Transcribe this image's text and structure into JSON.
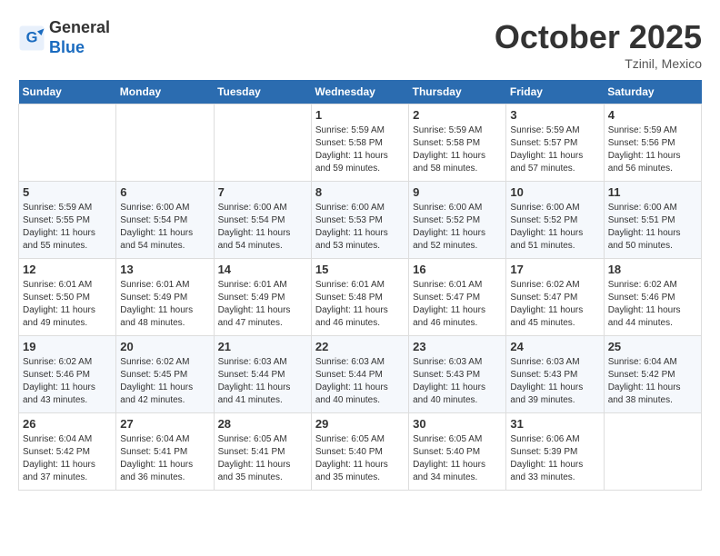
{
  "header": {
    "logo_line1": "General",
    "logo_line2": "Blue",
    "month": "October 2025",
    "location": "Tzinil, Mexico"
  },
  "weekdays": [
    "Sunday",
    "Monday",
    "Tuesday",
    "Wednesday",
    "Thursday",
    "Friday",
    "Saturday"
  ],
  "weeks": [
    [
      {
        "day": "",
        "info": ""
      },
      {
        "day": "",
        "info": ""
      },
      {
        "day": "",
        "info": ""
      },
      {
        "day": "1",
        "info": "Sunrise: 5:59 AM\nSunset: 5:58 PM\nDaylight: 11 hours\nand 59 minutes."
      },
      {
        "day": "2",
        "info": "Sunrise: 5:59 AM\nSunset: 5:58 PM\nDaylight: 11 hours\nand 58 minutes."
      },
      {
        "day": "3",
        "info": "Sunrise: 5:59 AM\nSunset: 5:57 PM\nDaylight: 11 hours\nand 57 minutes."
      },
      {
        "day": "4",
        "info": "Sunrise: 5:59 AM\nSunset: 5:56 PM\nDaylight: 11 hours\nand 56 minutes."
      }
    ],
    [
      {
        "day": "5",
        "info": "Sunrise: 5:59 AM\nSunset: 5:55 PM\nDaylight: 11 hours\nand 55 minutes."
      },
      {
        "day": "6",
        "info": "Sunrise: 6:00 AM\nSunset: 5:54 PM\nDaylight: 11 hours\nand 54 minutes."
      },
      {
        "day": "7",
        "info": "Sunrise: 6:00 AM\nSunset: 5:54 PM\nDaylight: 11 hours\nand 54 minutes."
      },
      {
        "day": "8",
        "info": "Sunrise: 6:00 AM\nSunset: 5:53 PM\nDaylight: 11 hours\nand 53 minutes."
      },
      {
        "day": "9",
        "info": "Sunrise: 6:00 AM\nSunset: 5:52 PM\nDaylight: 11 hours\nand 52 minutes."
      },
      {
        "day": "10",
        "info": "Sunrise: 6:00 AM\nSunset: 5:52 PM\nDaylight: 11 hours\nand 51 minutes."
      },
      {
        "day": "11",
        "info": "Sunrise: 6:00 AM\nSunset: 5:51 PM\nDaylight: 11 hours\nand 50 minutes."
      }
    ],
    [
      {
        "day": "12",
        "info": "Sunrise: 6:01 AM\nSunset: 5:50 PM\nDaylight: 11 hours\nand 49 minutes."
      },
      {
        "day": "13",
        "info": "Sunrise: 6:01 AM\nSunset: 5:49 PM\nDaylight: 11 hours\nand 48 minutes."
      },
      {
        "day": "14",
        "info": "Sunrise: 6:01 AM\nSunset: 5:49 PM\nDaylight: 11 hours\nand 47 minutes."
      },
      {
        "day": "15",
        "info": "Sunrise: 6:01 AM\nSunset: 5:48 PM\nDaylight: 11 hours\nand 46 minutes."
      },
      {
        "day": "16",
        "info": "Sunrise: 6:01 AM\nSunset: 5:47 PM\nDaylight: 11 hours\nand 46 minutes."
      },
      {
        "day": "17",
        "info": "Sunrise: 6:02 AM\nSunset: 5:47 PM\nDaylight: 11 hours\nand 45 minutes."
      },
      {
        "day": "18",
        "info": "Sunrise: 6:02 AM\nSunset: 5:46 PM\nDaylight: 11 hours\nand 44 minutes."
      }
    ],
    [
      {
        "day": "19",
        "info": "Sunrise: 6:02 AM\nSunset: 5:46 PM\nDaylight: 11 hours\nand 43 minutes."
      },
      {
        "day": "20",
        "info": "Sunrise: 6:02 AM\nSunset: 5:45 PM\nDaylight: 11 hours\nand 42 minutes."
      },
      {
        "day": "21",
        "info": "Sunrise: 6:03 AM\nSunset: 5:44 PM\nDaylight: 11 hours\nand 41 minutes."
      },
      {
        "day": "22",
        "info": "Sunrise: 6:03 AM\nSunset: 5:44 PM\nDaylight: 11 hours\nand 40 minutes."
      },
      {
        "day": "23",
        "info": "Sunrise: 6:03 AM\nSunset: 5:43 PM\nDaylight: 11 hours\nand 40 minutes."
      },
      {
        "day": "24",
        "info": "Sunrise: 6:03 AM\nSunset: 5:43 PM\nDaylight: 11 hours\nand 39 minutes."
      },
      {
        "day": "25",
        "info": "Sunrise: 6:04 AM\nSunset: 5:42 PM\nDaylight: 11 hours\nand 38 minutes."
      }
    ],
    [
      {
        "day": "26",
        "info": "Sunrise: 6:04 AM\nSunset: 5:42 PM\nDaylight: 11 hours\nand 37 minutes."
      },
      {
        "day": "27",
        "info": "Sunrise: 6:04 AM\nSunset: 5:41 PM\nDaylight: 11 hours\nand 36 minutes."
      },
      {
        "day": "28",
        "info": "Sunrise: 6:05 AM\nSunset: 5:41 PM\nDaylight: 11 hours\nand 35 minutes."
      },
      {
        "day": "29",
        "info": "Sunrise: 6:05 AM\nSunset: 5:40 PM\nDaylight: 11 hours\nand 35 minutes."
      },
      {
        "day": "30",
        "info": "Sunrise: 6:05 AM\nSunset: 5:40 PM\nDaylight: 11 hours\nand 34 minutes."
      },
      {
        "day": "31",
        "info": "Sunrise: 6:06 AM\nSunset: 5:39 PM\nDaylight: 11 hours\nand 33 minutes."
      },
      {
        "day": "",
        "info": ""
      }
    ]
  ]
}
